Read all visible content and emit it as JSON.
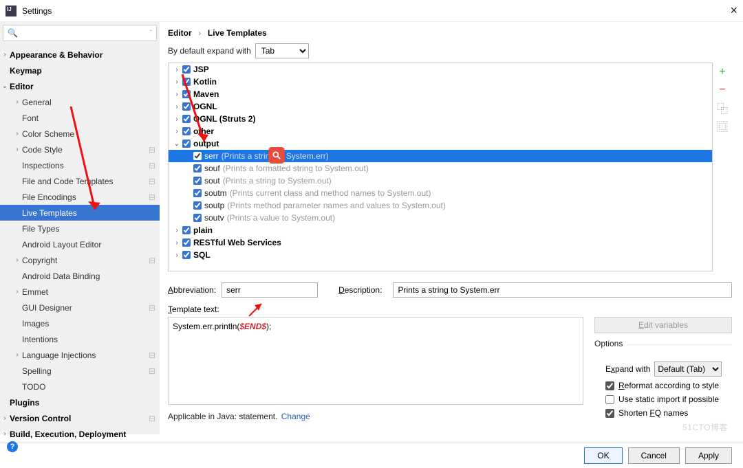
{
  "title": "Settings",
  "search_placeholder": "",
  "breadcrumb": {
    "a": "Editor",
    "b": "Live Templates"
  },
  "default_expand_label": "By default expand with",
  "default_expand_value": "Tab",
  "sidebar": [
    {
      "label": "Appearance & Behavior",
      "level": 0,
      "bold": true,
      "chev": "›"
    },
    {
      "label": "Keymap",
      "level": 0,
      "bold": true,
      "chev": ""
    },
    {
      "label": "Editor",
      "level": 0,
      "bold": true,
      "chev": "⌄"
    },
    {
      "label": "General",
      "level": 1,
      "chev": "›"
    },
    {
      "label": "Font",
      "level": 1,
      "chev": ""
    },
    {
      "label": "Color Scheme",
      "level": 1,
      "chev": "›"
    },
    {
      "label": "Code Style",
      "level": 1,
      "chev": "›",
      "pin": true
    },
    {
      "label": "Inspections",
      "level": 1,
      "chev": "",
      "pin": true
    },
    {
      "label": "File and Code Templates",
      "level": 1,
      "chev": "",
      "pin": true
    },
    {
      "label": "File Encodings",
      "level": 1,
      "chev": "",
      "pin": true
    },
    {
      "label": "Live Templates",
      "level": 1,
      "chev": "",
      "selected": true
    },
    {
      "label": "File Types",
      "level": 1,
      "chev": ""
    },
    {
      "label": "Android Layout Editor",
      "level": 1,
      "chev": ""
    },
    {
      "label": "Copyright",
      "level": 1,
      "chev": "›",
      "pin": true
    },
    {
      "label": "Android Data Binding",
      "level": 1,
      "chev": ""
    },
    {
      "label": "Emmet",
      "level": 1,
      "chev": "›"
    },
    {
      "label": "GUI Designer",
      "level": 1,
      "chev": "",
      "pin": true
    },
    {
      "label": "Images",
      "level": 1,
      "chev": ""
    },
    {
      "label": "Intentions",
      "level": 1,
      "chev": ""
    },
    {
      "label": "Language Injections",
      "level": 1,
      "chev": "›",
      "pin": true
    },
    {
      "label": "Spelling",
      "level": 1,
      "chev": "",
      "pin": true
    },
    {
      "label": "TODO",
      "level": 1,
      "chev": ""
    },
    {
      "label": "Plugins",
      "level": 0,
      "bold": true,
      "chev": ""
    },
    {
      "label": "Version Control",
      "level": 0,
      "bold": true,
      "chev": "›",
      "pin": true
    },
    {
      "label": "Build, Execution, Deployment",
      "level": 0,
      "bold": true,
      "chev": "›"
    }
  ],
  "groups": [
    {
      "label": "JSP",
      "open": false
    },
    {
      "label": "Kotlin",
      "open": false
    },
    {
      "label": "Maven",
      "open": false
    },
    {
      "label": "OGNL",
      "open": false
    },
    {
      "label": "OGNL (Struts 2)",
      "open": false
    },
    {
      "label": "other",
      "open": false
    },
    {
      "label": "output",
      "open": true,
      "items": [
        {
          "abbr": "serr",
          "desc": "(Prints a string to System.err)",
          "selected": true
        },
        {
          "abbr": "souf",
          "desc": "(Prints a formatted string to System.out)"
        },
        {
          "abbr": "sout",
          "desc": "(Prints a string to System.out)"
        },
        {
          "abbr": "soutm",
          "desc": "(Prints current class and method names to System.out)"
        },
        {
          "abbr": "soutp",
          "desc": "(Prints method parameter names and values to System.out)"
        },
        {
          "abbr": "soutv",
          "desc": "(Prints a value to System.out)"
        }
      ]
    },
    {
      "label": "plain",
      "open": false
    },
    {
      "label": "RESTful Web Services",
      "open": false
    },
    {
      "label": "SQL",
      "open": false
    }
  ],
  "side_actions": {
    "add": "+",
    "remove": "−",
    "copy": "⿻",
    "dup": "⿴"
  },
  "form": {
    "abbr_label": "Abbreviation:",
    "abbr_value": "serr",
    "desc_label": "Description:",
    "desc_value": "Prints a string to System.err",
    "tt_label": "Template text:",
    "tt_prefix": "System.err.println(",
    "tt_var": "$END$",
    "tt_suffix": ");",
    "edit_vars": "Edit variables"
  },
  "options": {
    "title": "Options",
    "expand_label": "Expand with",
    "expand_value": "Default (Tab)",
    "reformat": "Reformat according to style",
    "static_import": "Use static import if possible",
    "shorten": "Shorten FQ names"
  },
  "applicable": {
    "text": "Applicable in Java: statement.",
    "change": "Change"
  },
  "footer": {
    "ok": "OK",
    "cancel": "Cancel",
    "apply": "Apply"
  },
  "watermark": "51CTO博客"
}
